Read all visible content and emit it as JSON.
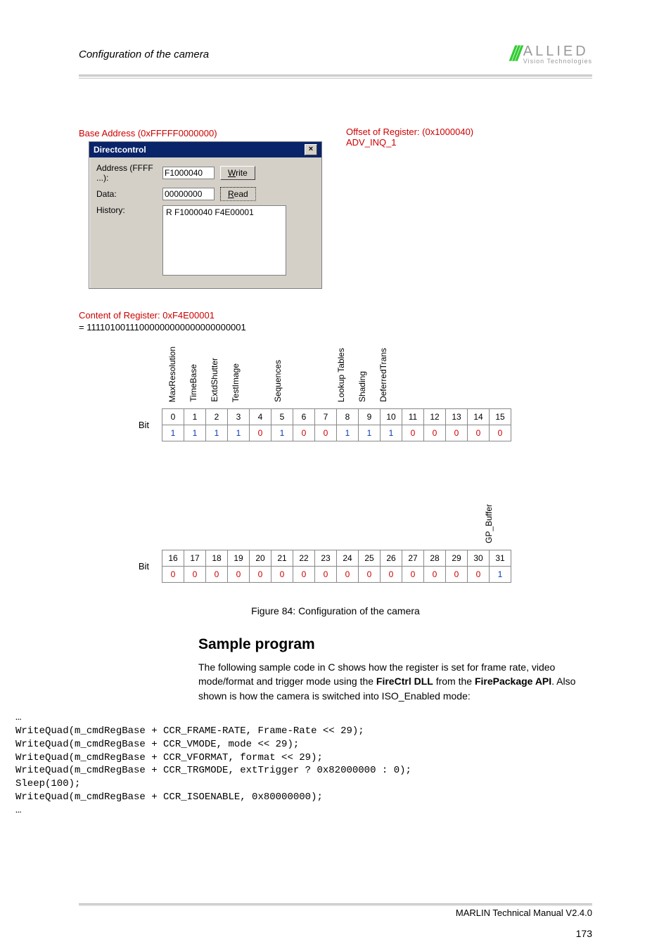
{
  "header": {
    "title": "Configuration of the camera",
    "logo_main": "ALLIED",
    "logo_sub": "Vision Technologies"
  },
  "figure": {
    "base_address_label": "Base Address (0xFFFFF0000000)",
    "offset_line1": "Offset of Register: (0x1000040)",
    "offset_line2": "ADV_INQ_1",
    "dc_title": "Directcontrol",
    "dc_close": "×",
    "address_label": "Address (FFFF ...):",
    "address_val": "F1000040",
    "write_label_pre": "W",
    "write_label_rest": "rite",
    "data_label": "Data:",
    "data_val": "00000000",
    "read_label_pre": "R",
    "read_label_rest": "ead",
    "history_label": "History:",
    "history_val": "R F1000040 F4E00001",
    "content_label": "Content of Register:  0xF4E00001",
    "bin_label": "= 11110100111000000000000000000001",
    "bit_word": "Bit",
    "row1_headers": [
      "MaxResolution",
      "TimeBase",
      "ExtdShutter",
      "TestImage",
      "",
      "Sequences",
      "",
      "",
      "Lookup Tables",
      "Shading",
      "DeferredTrans",
      "",
      "",
      "",
      "",
      ""
    ],
    "row1_bits": [
      "0",
      "1",
      "2",
      "3",
      "4",
      "5",
      "6",
      "7",
      "8",
      "9",
      "10",
      "11",
      "12",
      "13",
      "14",
      "15"
    ],
    "row1_vals": [
      "1",
      "1",
      "1",
      "1",
      "0",
      "1",
      "0",
      "0",
      "1",
      "1",
      "1",
      "0",
      "0",
      "0",
      "0",
      "0"
    ],
    "row2_headers": [
      "",
      "",
      "",
      "",
      "",
      "",
      "",
      "",
      "",
      "",
      "",
      "",
      "",
      "",
      "",
      "GP_Buffer"
    ],
    "row2_bits": [
      "16",
      "17",
      "18",
      "19",
      "20",
      "21",
      "22",
      "23",
      "24",
      "25",
      "26",
      "27",
      "28",
      "29",
      "30",
      "31"
    ],
    "row2_vals": [
      "0",
      "0",
      "0",
      "0",
      "0",
      "0",
      "0",
      "0",
      "0",
      "0",
      "0",
      "0",
      "0",
      "0",
      "0",
      "1"
    ],
    "caption": "Figure 84: Configuration of the camera"
  },
  "section": {
    "heading": "Sample program",
    "para_pre": "The following sample code in C shows how the register is set for frame rate, video mode/format and trigger mode using the ",
    "bold1": "FireCtrl DLL",
    "mid1": " from the ",
    "bold2": "FirePackage API",
    "post": ". Also shown is how the camera is switched into ISO_Enabled mode:"
  },
  "code_lines": [
    "…",
    "WriteQuad(m_cmdRegBase + CCR_FRAME-RATE, Frame-Rate << 29);",
    "WriteQuad(m_cmdRegBase + CCR_VMODE, mode << 29);",
    "WriteQuad(m_cmdRegBase + CCR_VFORMAT, format << 29);",
    "WriteQuad(m_cmdRegBase + CCR_TRGMODE, extTrigger ? 0x82000000 : 0);",
    "Sleep(100);",
    "WriteQuad(m_cmdRegBase + CCR_ISOENABLE, 0x80000000);",
    "…"
  ],
  "footer": {
    "text": "MARLIN Technical Manual V2.4.0",
    "page": "173"
  }
}
